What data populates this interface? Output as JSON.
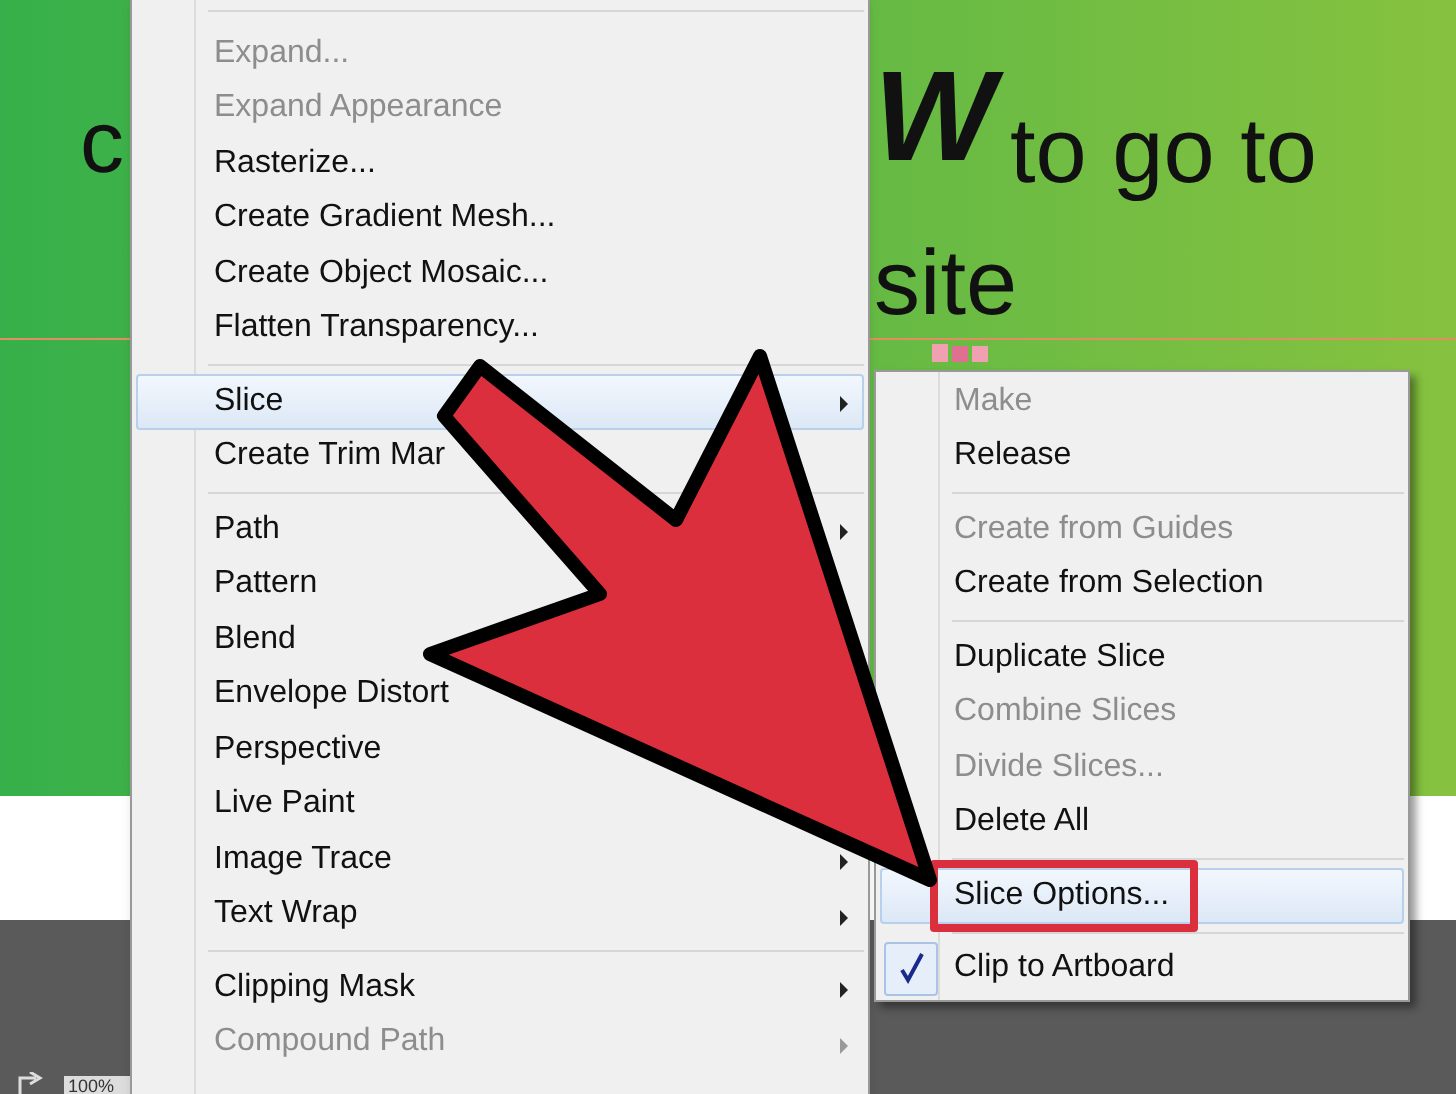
{
  "artwork": {
    "line_1_start": "c",
    "line_1_bold": "W",
    "line_1_end": "to go to",
    "line_2_end": "site"
  },
  "status_bar": {
    "zoom": "100%"
  },
  "menu": {
    "items": [
      {
        "kind": "separator"
      },
      {
        "kind": "item",
        "label": "Expand...",
        "disabled": true,
        "submenu": false,
        "selected": false
      },
      {
        "kind": "item",
        "label": "Expand Appearance",
        "disabled": true,
        "submenu": false,
        "selected": false
      },
      {
        "kind": "item",
        "label": "Rasterize...",
        "disabled": false,
        "submenu": false,
        "selected": false
      },
      {
        "kind": "item",
        "label": "Create Gradient Mesh...",
        "disabled": false,
        "submenu": false,
        "selected": false
      },
      {
        "kind": "item",
        "label": "Create Object Mosaic...",
        "disabled": false,
        "submenu": false,
        "selected": false
      },
      {
        "kind": "item",
        "label": "Flatten Transparency...",
        "disabled": false,
        "submenu": false,
        "selected": false
      },
      {
        "kind": "separator"
      },
      {
        "kind": "item",
        "label": "Slice",
        "disabled": false,
        "submenu": true,
        "selected": true
      },
      {
        "kind": "item",
        "label": "Create Trim Mar",
        "disabled": false,
        "submenu": false,
        "selected": false
      },
      {
        "kind": "separator"
      },
      {
        "kind": "item",
        "label": "Path",
        "disabled": false,
        "submenu": true,
        "selected": false
      },
      {
        "kind": "item",
        "label": "Pattern",
        "disabled": false,
        "submenu": false,
        "selected": false
      },
      {
        "kind": "item",
        "label": "Blend",
        "disabled": false,
        "submenu": false,
        "selected": false
      },
      {
        "kind": "item",
        "label": "Envelope Distort",
        "disabled": false,
        "submenu": false,
        "selected": false
      },
      {
        "kind": "item",
        "label": "Perspective",
        "disabled": false,
        "submenu": false,
        "selected": false
      },
      {
        "kind": "item",
        "label": "Live Paint",
        "disabled": false,
        "submenu": false,
        "selected": false
      },
      {
        "kind": "item",
        "label": "Image Trace",
        "disabled": false,
        "submenu": true,
        "selected": false
      },
      {
        "kind": "item",
        "label": "Text Wrap",
        "disabled": false,
        "submenu": true,
        "selected": false
      },
      {
        "kind": "separator"
      },
      {
        "kind": "item",
        "label": "Clipping Mask",
        "disabled": false,
        "submenu": true,
        "selected": false
      },
      {
        "kind": "item",
        "label": "Compound Path",
        "disabled": true,
        "submenu": true,
        "selected": false
      }
    ]
  },
  "submenu": {
    "items": [
      {
        "kind": "item",
        "label": "Make",
        "disabled": true,
        "checked": false,
        "selected": false,
        "outlined": false
      },
      {
        "kind": "item",
        "label": "Release",
        "disabled": false,
        "checked": false,
        "selected": false,
        "outlined": false
      },
      {
        "kind": "separator"
      },
      {
        "kind": "item",
        "label": "Create from Guides",
        "disabled": true,
        "checked": false,
        "selected": false,
        "outlined": false
      },
      {
        "kind": "item",
        "label": "Create from Selection",
        "disabled": false,
        "checked": false,
        "selected": false,
        "outlined": false
      },
      {
        "kind": "separator"
      },
      {
        "kind": "item",
        "label": "Duplicate Slice",
        "disabled": false,
        "checked": false,
        "selected": false,
        "outlined": false
      },
      {
        "kind": "item",
        "label": "Combine Slices",
        "disabled": true,
        "checked": false,
        "selected": false,
        "outlined": false
      },
      {
        "kind": "item",
        "label": "Divide Slices...",
        "disabled": true,
        "checked": false,
        "selected": false,
        "outlined": false
      },
      {
        "kind": "item",
        "label": "Delete All",
        "disabled": false,
        "checked": false,
        "selected": false,
        "outlined": false
      },
      {
        "kind": "separator"
      },
      {
        "kind": "item",
        "label": "Slice Options...",
        "disabled": false,
        "checked": false,
        "selected": true,
        "outlined": true
      },
      {
        "kind": "separator"
      },
      {
        "kind": "item",
        "label": "Clip to Artboard",
        "disabled": false,
        "checked": true,
        "selected": false,
        "outlined": false
      }
    ]
  }
}
